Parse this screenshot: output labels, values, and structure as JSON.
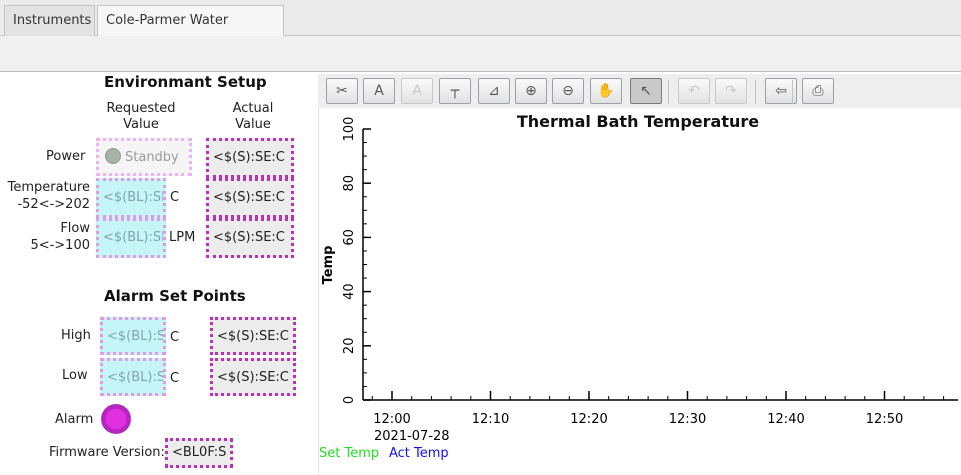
{
  "tabs": [
    {
      "label": "Instruments"
    },
    {
      "label": "Cole-Parmer Water Bath",
      "close": "✕"
    }
  ],
  "setup": {
    "title": "Environmant Setup",
    "col_requested": "Requested\nValue",
    "col_actual": "Actual\nValue",
    "power_label": "Power",
    "power_button": "Standby",
    "power_actual": "<$(S):SE:C",
    "temp_label": "Temperature\n-52<->202",
    "temp_input": "<$(BL):SE",
    "temp_unit": "C",
    "temp_actual": "<$(S):SE:C",
    "flow_label": "Flow\n5<->100",
    "flow_input": "<$(BL):SE",
    "flow_unit": "LPM",
    "flow_actual": "<$(S):SE:C"
  },
  "alarm": {
    "title": "Alarm Set Points",
    "high_label": "High",
    "high_input": "<$(BL):SE",
    "high_unit": "C",
    "high_actual": "<$(S):SE:C",
    "low_label": "Low",
    "low_input": "<$(BL):SE",
    "low_unit": "C",
    "low_actual": "<$(S):SE:C",
    "alarm_label": "Alarm",
    "alarm_color": "#e030e0"
  },
  "firmware": {
    "label": "Firmware Version:",
    "value": "<BL0F:S"
  },
  "plot_toolbar": [
    {
      "icon": "scissors-icon",
      "glyph": "✂",
      "enabled": true
    },
    {
      "icon": "text-edit-icon",
      "glyph": "A",
      "enabled": true
    },
    {
      "icon": "text-label-icon",
      "glyph": "A",
      "enabled": false
    },
    {
      "icon": "axis-icon",
      "glyph": "┬",
      "enabled": true
    },
    {
      "icon": "chart-scale-icon",
      "glyph": "⊿",
      "enabled": true
    },
    {
      "icon": "zoom-in-icon",
      "glyph": "⊕",
      "enabled": true
    },
    {
      "icon": "zoom-out-icon",
      "glyph": "⊖",
      "enabled": true
    },
    {
      "icon": "hand-pan-icon",
      "glyph": "✋",
      "enabled": true
    },
    {
      "icon": "pointer-icon",
      "glyph": "↖",
      "enabled": true,
      "pressed": true
    },
    {
      "icon": "undo-icon",
      "glyph": "↶",
      "enabled": false
    },
    {
      "icon": "redo-icon",
      "glyph": "↷",
      "enabled": false
    },
    {
      "icon": "back-arrow-icon",
      "glyph": "⇦",
      "enabled": true
    },
    {
      "icon": "print-icon",
      "glyph": "⎙",
      "enabled": true
    }
  ],
  "chart_data": {
    "type": "line",
    "title": "Thermal Bath Temperature",
    "ylabel": "Temp",
    "xlabel": "",
    "ylim": [
      0,
      100
    ],
    "yticks": [
      "0",
      "20",
      "40",
      "60",
      "80",
      "100"
    ],
    "xticks": [
      "12:00",
      "12:10",
      "12:20",
      "12:30",
      "12:40",
      "12:50"
    ],
    "x_date": "2021-07-28",
    "series": [
      {
        "name": "Set Temp",
        "color": "#22dd22",
        "values": []
      },
      {
        "name": "Act Temp",
        "color": "#1010ee",
        "values": []
      }
    ]
  }
}
